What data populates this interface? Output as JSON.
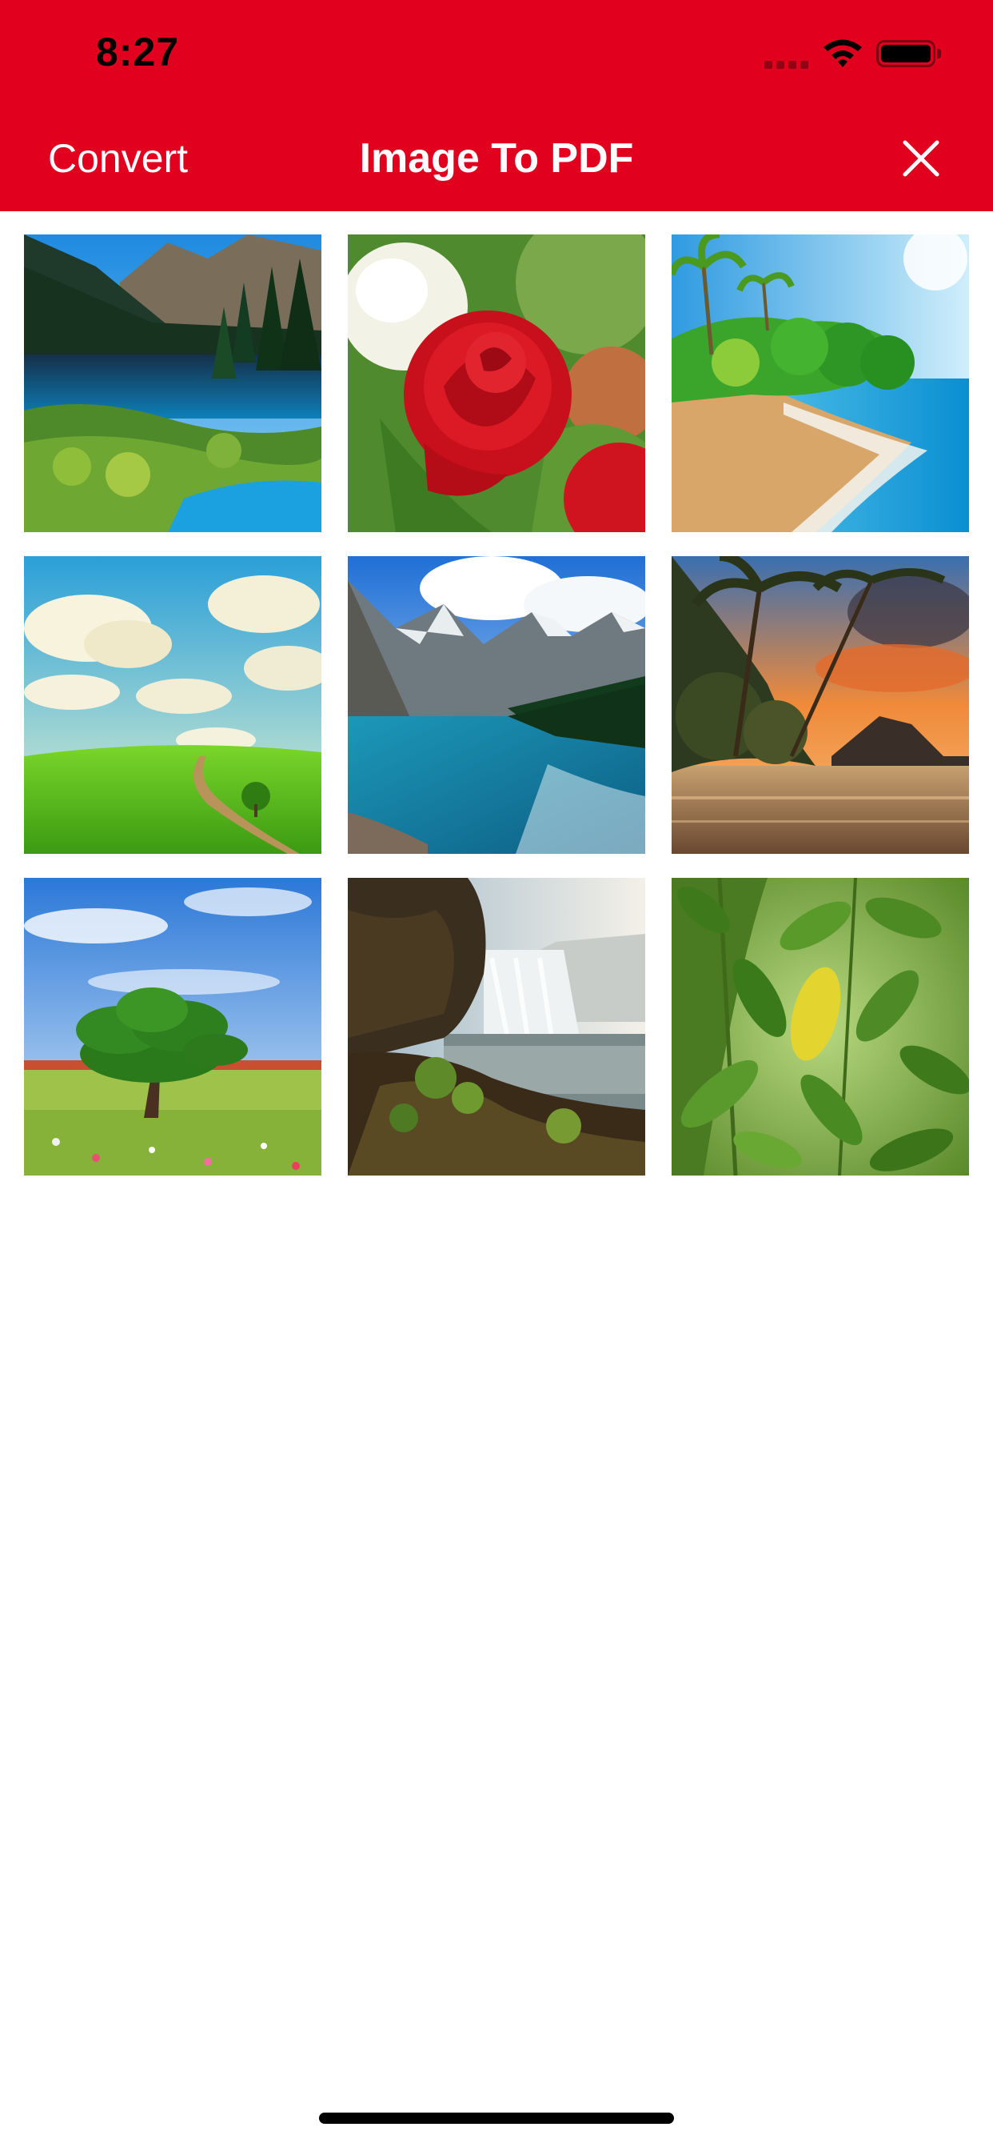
{
  "status_bar": {
    "time": "8:27"
  },
  "nav": {
    "left_action": "Convert",
    "title": "Image To PDF",
    "close_icon": "close-icon"
  },
  "colors": {
    "header_background": "#e2001f",
    "header_text": "#ffffff",
    "page_background": "#ffffff"
  },
  "images": [
    {
      "subject": "mountain lake with pine forest"
    },
    {
      "subject": "red rose"
    },
    {
      "subject": "tropical beach with palm trees"
    },
    {
      "subject": "green meadow under cloudy sky"
    },
    {
      "subject": "turquoise mountain lake"
    },
    {
      "subject": "tropical sunset with palm trees"
    },
    {
      "subject": "lone tree in flower field"
    },
    {
      "subject": "waterfall over rocky cliff"
    },
    {
      "subject": "green leaves"
    }
  ]
}
